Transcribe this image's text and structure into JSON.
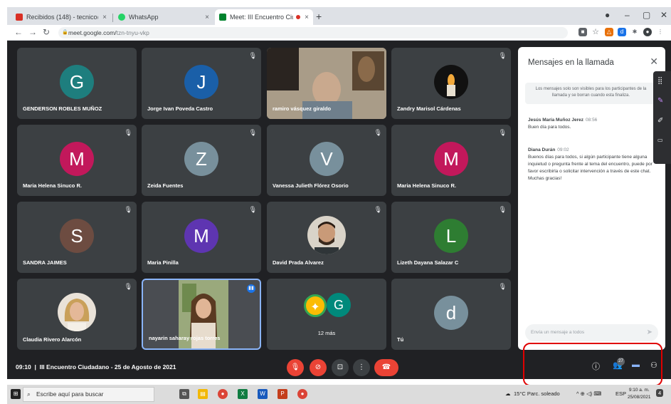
{
  "browser": {
    "tabs": [
      {
        "title": "Recibidos (148) - tecnico@comi…",
        "icon": "gmail-icon"
      },
      {
        "title": "WhatsApp",
        "icon": "whatsapp-icon"
      },
      {
        "title": "Meet: III Encuentro Ciudada…",
        "icon": "meet-icon"
      }
    ],
    "url_host": "meet.google.com/",
    "url_path": "tzn-tnyu-vkp"
  },
  "tiles": [
    {
      "letter": "G",
      "name": "GENDERSON ROBLES MUÑOZ",
      "color": "#1e7e7e"
    },
    {
      "letter": "J",
      "name": "Jorge Ivan Poveda Castro",
      "color": "#1a5fa8"
    },
    {
      "letter": "",
      "name": "ramiro vásquez giraldo",
      "color": ""
    },
    {
      "letter": "",
      "name": "Zandry Marisol Cárdenas",
      "color": ""
    },
    {
      "letter": "M",
      "name": "Maria Helena Sinuco R.",
      "color": "#c2185b"
    },
    {
      "letter": "Z",
      "name": "Zeida Fuentes",
      "color": "#78909c"
    },
    {
      "letter": "V",
      "name": "Vanessa Julieth Flórez Osorio",
      "color": "#78909c"
    },
    {
      "letter": "M",
      "name": "Maria Helena Sinuco R.",
      "color": "#c2185b"
    },
    {
      "letter": "S",
      "name": "SANDRA JAIMES",
      "color": "#6d4c41"
    },
    {
      "letter": "M",
      "name": "Maria Pinilla",
      "color": "#5e35b1"
    },
    {
      "letter": "",
      "name": "David Prada Alvarez",
      "color": ""
    },
    {
      "letter": "L",
      "name": "Lizeth Dayana Salazar C",
      "color": "#2e7d32"
    },
    {
      "letter": "",
      "name": "Claudia Rivero Alarcón",
      "color": ""
    },
    {
      "letter": "",
      "name": "nayarin saharay rojas torres",
      "color": ""
    },
    {
      "letter": "G",
      "name": "12 más",
      "color": "#00897b"
    },
    {
      "letter": "d",
      "name": "Tú",
      "color": "#78909c"
    }
  ],
  "chat": {
    "title": "Mensajes en la llamada",
    "notice": "Los mensajes solo son visibles para los participantes de la llamada y se borran cuando esta finaliza.",
    "messages": [
      {
        "sender": "Jesús María Muñoz Jerez",
        "time": "08:56",
        "text": "Buen día para todos."
      },
      {
        "sender": "Diana Durán",
        "time": "09:02",
        "text": "Buenos días para todos, si algún participante tiene alguna inquietud o pregunta frente al tema del encuentro, puede por favor escribirla o solicitar intervención a través de este chat. Muchas gracias!"
      }
    ],
    "input_placeholder": "Envía un mensaje a todos"
  },
  "meeting": {
    "time": "09:10",
    "title": "III Encuentro Ciudadano - 25 de Agosto de 2021",
    "participants_count": "27"
  },
  "taskbar": {
    "search_placeholder": "Escribe aquí para buscar",
    "weather": "15°C  Parc. soleado",
    "lang": "ESP",
    "clock_time": "9:10 a. m.",
    "clock_date": "25/08/2021",
    "notifications": "4"
  },
  "colors": {
    "meet_bg": "#202124",
    "tile_bg": "#3c4043",
    "end_call": "#ea4335",
    "highlight": "#e00000"
  }
}
